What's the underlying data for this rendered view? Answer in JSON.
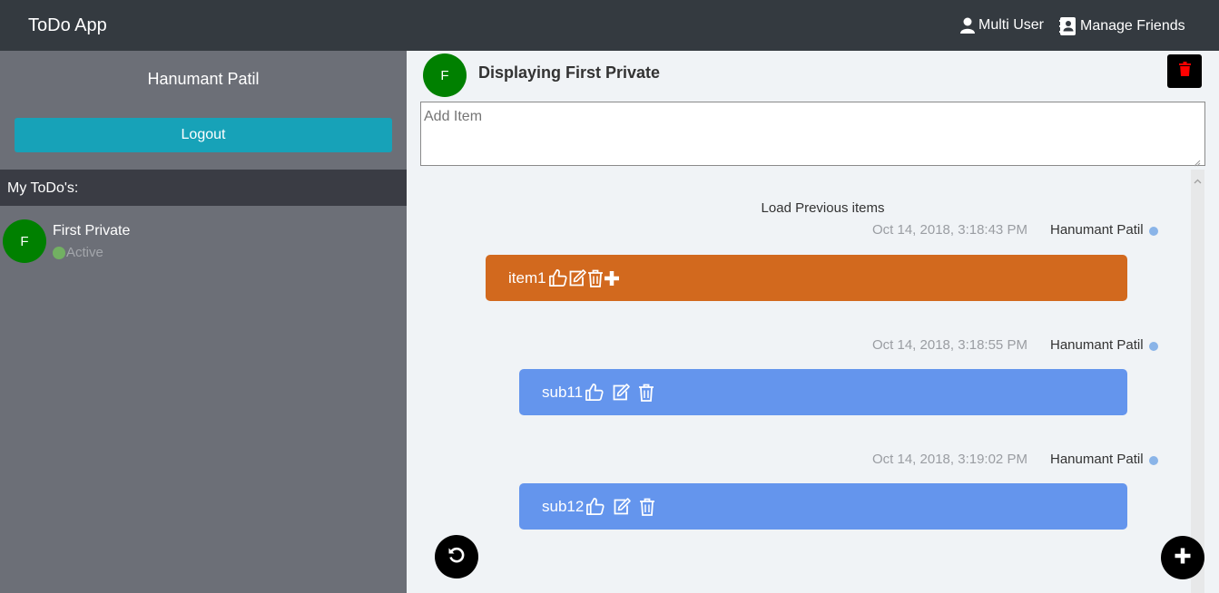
{
  "navbar": {
    "brand": "ToDo App",
    "multi_user_label": "Multi User",
    "manage_friends_label": "Manage Friends"
  },
  "sidebar": {
    "user_name": "Hanumant Patil",
    "logout_label": "Logout",
    "section_title": "My ToDo's:",
    "todos": [
      {
        "avatar_letter": "F",
        "name": "First Private",
        "status": "Active"
      }
    ]
  },
  "main": {
    "avatar_letter": "F",
    "title": "Displaying First Private",
    "add_item_placeholder": "Add Item",
    "load_previous_label": "Load Previous items",
    "items": [
      {
        "timestamp": "Oct 14, 2018, 3:18:43 PM",
        "author": "Hanumant Patil",
        "text": "item1",
        "color": "#d2691e"
      },
      {
        "timestamp": "Oct 14, 2018, 3:18:55 PM",
        "author": "Hanumant Patil",
        "text": "sub11",
        "color": "#6495ed"
      },
      {
        "timestamp": "Oct 14, 2018, 3:19:02 PM",
        "author": "Hanumant Patil",
        "text": "sub12",
        "color": "#6495ed"
      }
    ]
  },
  "colors": {
    "navbar": "#343a40",
    "sidebar": "#6c6f77",
    "logout": "#17a2b8",
    "avatar": "#008000",
    "delete_icon": "#ff0000"
  }
}
